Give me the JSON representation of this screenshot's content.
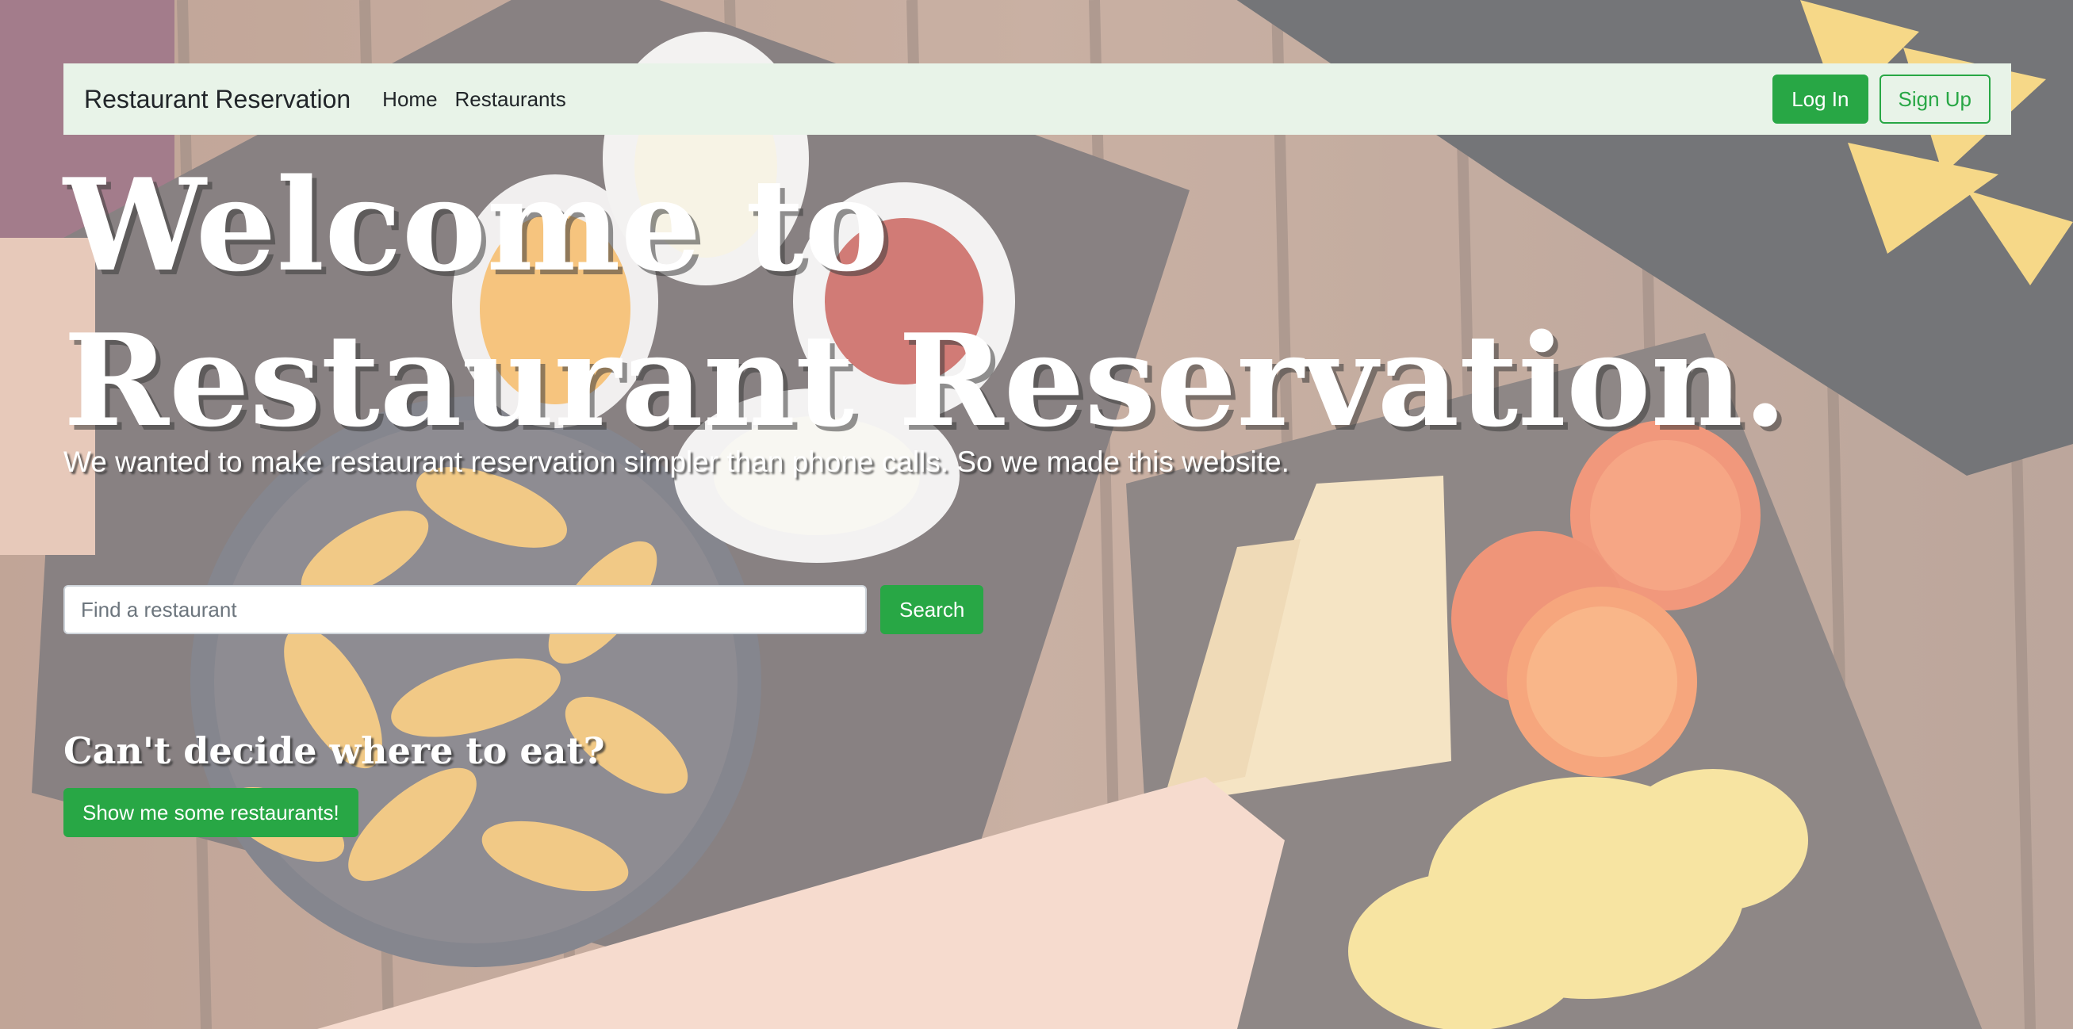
{
  "navbar": {
    "brand": "Restaurant Reservation",
    "links": [
      "Home",
      "Restaurants"
    ],
    "login_label": "Log In",
    "signup_label": "Sign Up"
  },
  "hero": {
    "title_line1": "Welcome to",
    "title_line2": "Restaurant Reservation.",
    "subtitle": "We wanted to make restaurant reservation simpler than phone calls. So we made this website.",
    "background_image": "food-table-photo"
  },
  "search": {
    "placeholder": "Find a restaurant",
    "value": "",
    "button_label": "Search"
  },
  "suggest": {
    "heading": "Can't decide where to eat?",
    "button_label": "Show me some restaurants!"
  },
  "colors": {
    "accent": "#28a745",
    "navbar_bg": "#e8f3e8"
  }
}
